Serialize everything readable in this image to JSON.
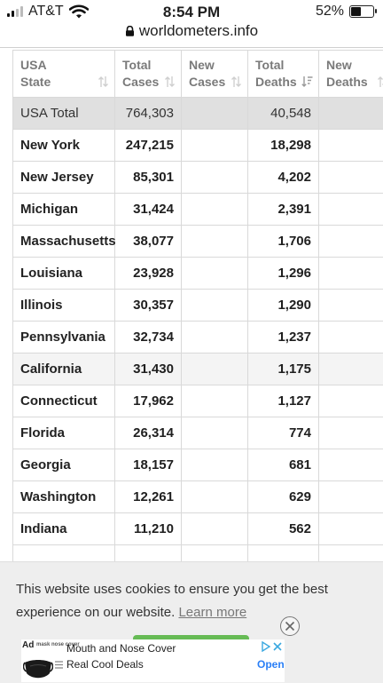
{
  "status_bar": {
    "carrier": "AT&T",
    "time": "8:54 PM",
    "battery": "52%",
    "battery_level": 0.52,
    "signal_bars_active": 2,
    "signal_bars_total": 4
  },
  "browser": {
    "url": "worldometers.info",
    "lock_icon": "lock-icon"
  },
  "table": {
    "headers": [
      {
        "line1": "USA",
        "line2": "State"
      },
      {
        "line1": "Total",
        "line2": "Cases"
      },
      {
        "line1": "New",
        "line2": "Cases"
      },
      {
        "line1": "Total",
        "line2": "Deaths"
      },
      {
        "line1": "New",
        "line2": "Deaths"
      }
    ],
    "rows": [
      {
        "state": "USA Total",
        "total_cases": "764,303",
        "new_cases": "",
        "total_deaths": "40,548",
        "new_deaths": ""
      },
      {
        "state": "New York",
        "total_cases": "247,215",
        "new_cases": "",
        "total_deaths": "18,298",
        "new_deaths": ""
      },
      {
        "state": "New Jersey",
        "total_cases": "85,301",
        "new_cases": "",
        "total_deaths": "4,202",
        "new_deaths": ""
      },
      {
        "state": "Michigan",
        "total_cases": "31,424",
        "new_cases": "",
        "total_deaths": "2,391",
        "new_deaths": ""
      },
      {
        "state": "Massachusetts",
        "total_cases": "38,077",
        "new_cases": "",
        "total_deaths": "1,706",
        "new_deaths": ""
      },
      {
        "state": "Louisiana",
        "total_cases": "23,928",
        "new_cases": "",
        "total_deaths": "1,296",
        "new_deaths": ""
      },
      {
        "state": "Illinois",
        "total_cases": "30,357",
        "new_cases": "",
        "total_deaths": "1,290",
        "new_deaths": ""
      },
      {
        "state": "Pennsylvania",
        "total_cases": "32,734",
        "new_cases": "",
        "total_deaths": "1,237",
        "new_deaths": ""
      },
      {
        "state": "California",
        "total_cases": "31,430",
        "new_cases": "",
        "total_deaths": "1,175",
        "new_deaths": ""
      },
      {
        "state": "Connecticut",
        "total_cases": "17,962",
        "new_cases": "",
        "total_deaths": "1,127",
        "new_deaths": ""
      },
      {
        "state": "Florida",
        "total_cases": "26,314",
        "new_cases": "",
        "total_deaths": "774",
        "new_deaths": ""
      },
      {
        "state": "Georgia",
        "total_cases": "18,157",
        "new_cases": "",
        "total_deaths": "681",
        "new_deaths": ""
      },
      {
        "state": "Washington",
        "total_cases": "12,261",
        "new_cases": "",
        "total_deaths": "629",
        "new_deaths": ""
      },
      {
        "state": "Indiana",
        "total_cases": "11,210",
        "new_cases": "",
        "total_deaths": "562",
        "new_deaths": ""
      }
    ],
    "sort_icon": "sort-arrows-icon",
    "active_sort_icon": "sort-descending-icon"
  },
  "cookie_banner": {
    "text": "This website uses cookies to ensure you get the best experience on our website.",
    "link": "Learn more",
    "close_icon": "close-circle-icon",
    "accept_color": "#66bb55"
  },
  "ad": {
    "badge": "Ad",
    "brand_tiny": "mask nose cover",
    "title": "Mouth and Nose Cover",
    "subtitle": "Real Cool Deals",
    "cta": "Open",
    "image_icon": "face-mask-image",
    "choices_icon": "adchoices-icon",
    "menu_icon": "list-menu-icon"
  },
  "colors": {
    "total_row_bg": "#e0e0e0",
    "highlight_row_bg": "#f4f4f4",
    "header_text": "#7a7a7a",
    "link_blue": "#2a7ff6"
  }
}
